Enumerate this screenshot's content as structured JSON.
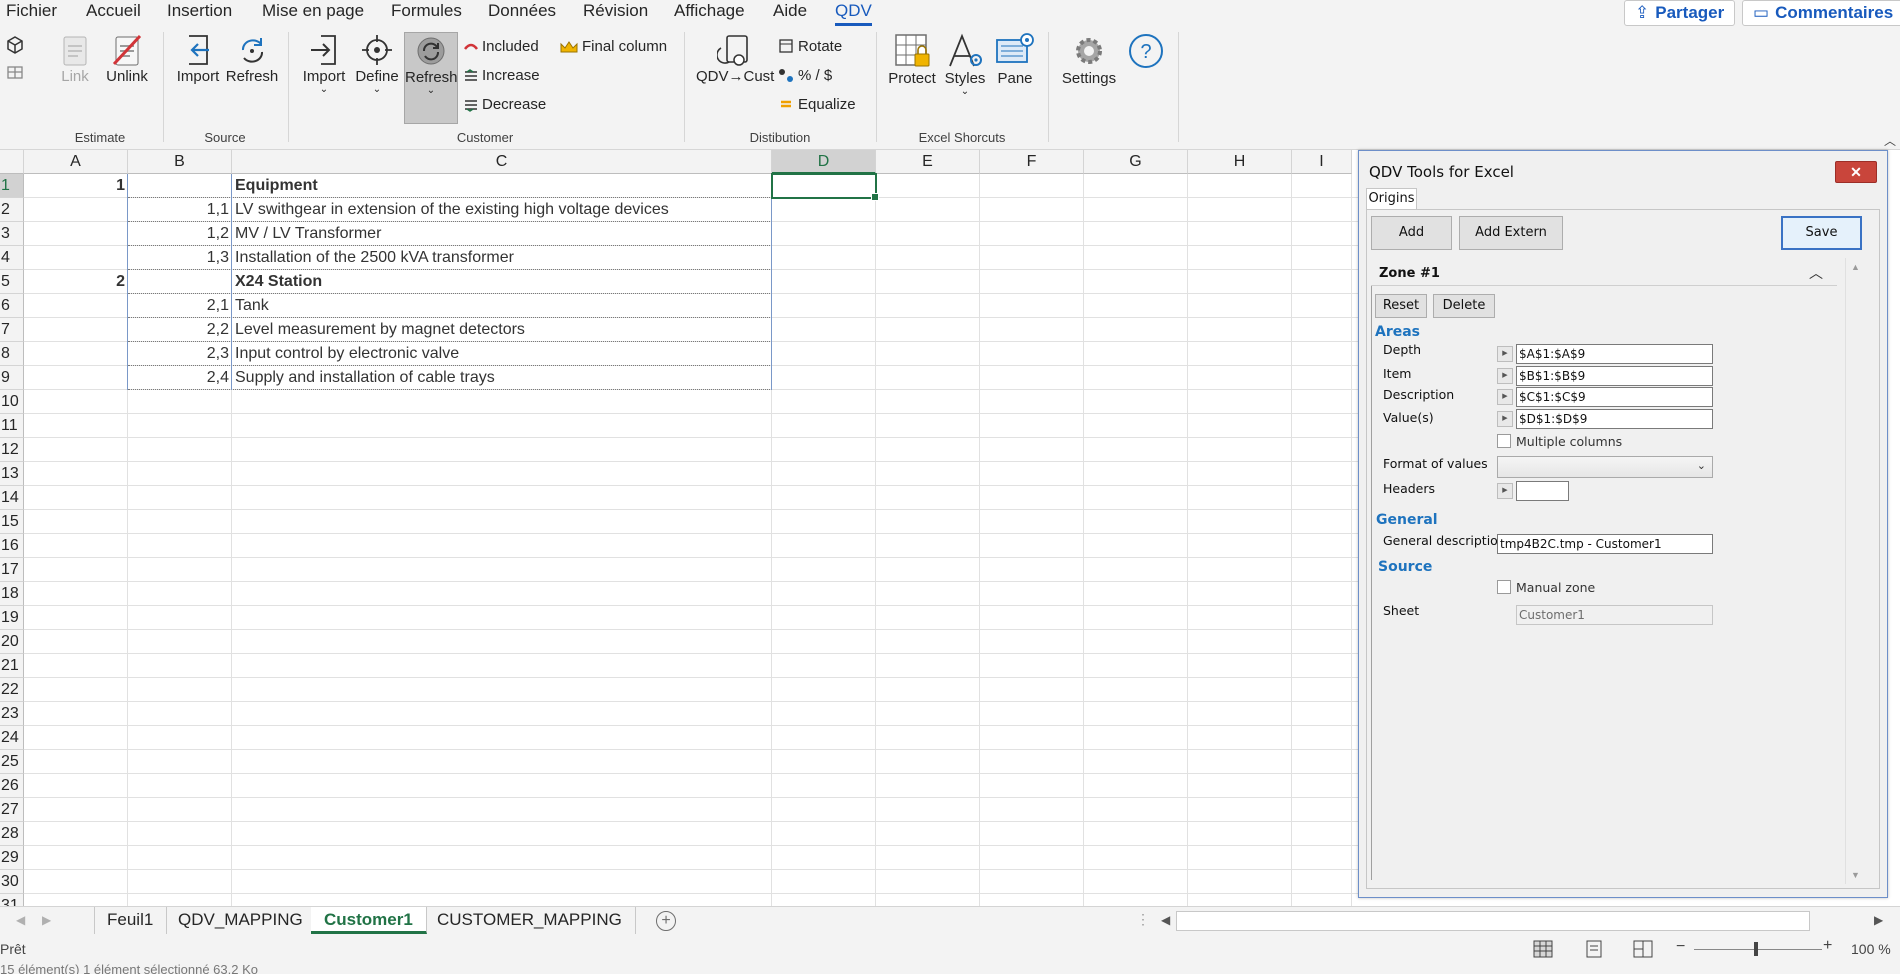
{
  "menu": {
    "tabs": [
      "Fichier",
      "Accueil",
      "Insertion",
      "Mise en page",
      "Formules",
      "Données",
      "Révision",
      "Affichage",
      "Aide",
      "QDV"
    ],
    "active": "QDV",
    "share_label": "Partager",
    "comments_label": "Commentaires"
  },
  "ribbon": {
    "estimate": {
      "label": "Estimate",
      "link": "Link",
      "unlink": "Unlink"
    },
    "source": {
      "label": "Source",
      "import": "Import",
      "refresh": "Refresh"
    },
    "customer": {
      "label": "Customer",
      "import": "Import",
      "define": "Define",
      "refresh": "Refresh",
      "included": "Included",
      "increase": "Increase",
      "decrease": "Decrease",
      "final_column": "Final column"
    },
    "distribution": {
      "label": "Distibution",
      "qdv_cust": "QDV→Cust",
      "rotate": "Rotate",
      "percent": "% / $",
      "equalize": "Equalize"
    },
    "excel_shortcuts": {
      "label": "Excel Shorcuts",
      "protect": "Protect",
      "styles": "Styles",
      "pane": "Pane"
    },
    "settings": "Settings",
    "help_glyph": "?"
  },
  "sheet": {
    "columns": [
      "A",
      "B",
      "C",
      "D",
      "E",
      "F",
      "G",
      "H",
      "I"
    ],
    "selected_column": "D",
    "selected_row": "1",
    "rows": [
      {
        "n": "1",
        "a": "1",
        "b": "",
        "c": "Equipment",
        "bold": true
      },
      {
        "n": "2",
        "a": "",
        "b": "1,1",
        "c": "LV swithgear in extension of the existing high voltage devices",
        "bold": false
      },
      {
        "n": "3",
        "a": "",
        "b": "1,2",
        "c": "MV / LV Transformer",
        "bold": false
      },
      {
        "n": "4",
        "a": "",
        "b": "1,3",
        "c": "Installation of the 2500 kVA transformer",
        "bold": false
      },
      {
        "n": "5",
        "a": "2",
        "b": "",
        "c": "X24 Station",
        "bold": true
      },
      {
        "n": "6",
        "a": "",
        "b": "2,1",
        "c": "Tank",
        "bold": false
      },
      {
        "n": "7",
        "a": "",
        "b": "2,2",
        "c": "Level measurement by magnet detectors",
        "bold": false
      },
      {
        "n": "8",
        "a": "",
        "b": "2,3",
        "c": "Input control by electronic valve",
        "bold": false
      },
      {
        "n": "9",
        "a": "",
        "b": "2,4",
        "c": "Supply and installation of cable trays",
        "bold": false
      },
      {
        "n": "10"
      },
      {
        "n": "11"
      },
      {
        "n": "12"
      },
      {
        "n": "13"
      },
      {
        "n": "14"
      },
      {
        "n": "15"
      },
      {
        "n": "16"
      },
      {
        "n": "17"
      },
      {
        "n": "18"
      },
      {
        "n": "19"
      },
      {
        "n": "20"
      },
      {
        "n": "21"
      },
      {
        "n": "22"
      },
      {
        "n": "23"
      },
      {
        "n": "24"
      },
      {
        "n": "25"
      },
      {
        "n": "26"
      },
      {
        "n": "27"
      },
      {
        "n": "28"
      },
      {
        "n": "29"
      },
      {
        "n": "30"
      },
      {
        "n": "31"
      }
    ]
  },
  "sheet_tabs": [
    "Feuil1",
    "QDV_MAPPING",
    "Customer1",
    "CUSTOMER_MAPPING"
  ],
  "active_sheet": "Customer1",
  "status": {
    "ready": "Prêt",
    "below": "15 élément(s)      1 élément sélectionné  63,2 Ko",
    "zoom": "100 %"
  },
  "pane": {
    "title": "QDV Tools for Excel",
    "close_glyph": "✕",
    "tab": "Origins",
    "buttons": {
      "add": "Add",
      "add_extern": "Add Extern",
      "save": "Save"
    },
    "zone": {
      "title": "Zone #1",
      "reset": "Reset",
      "delete": "Delete",
      "areas_title": "Areas",
      "fields": [
        {
          "label": "Depth",
          "value": "$A$1:$A$9"
        },
        {
          "label": "Item",
          "value": "$B$1:$B$9"
        },
        {
          "label": "Description",
          "value": "$C$1:$C$9"
        },
        {
          "label": "Value(s)",
          "value": "$D$1:$D$9"
        }
      ],
      "multiple_columns": "Multiple columns",
      "format_label": "Format of values",
      "format_value": "",
      "headers_label": "Headers",
      "headers_value": "",
      "general_title": "General",
      "general_desc_label": "General description",
      "general_desc_value": "tmp4B2C.tmp - Customer1",
      "source_title": "Source",
      "manual_zone": "Manual zone",
      "sheet_label": "Sheet",
      "sheet_value": "Customer1"
    }
  },
  "colors": {
    "excel_green": "#217346",
    "accent_blue": "#185abd",
    "section_blue": "#1e73be",
    "close_red": "#c9453b"
  }
}
